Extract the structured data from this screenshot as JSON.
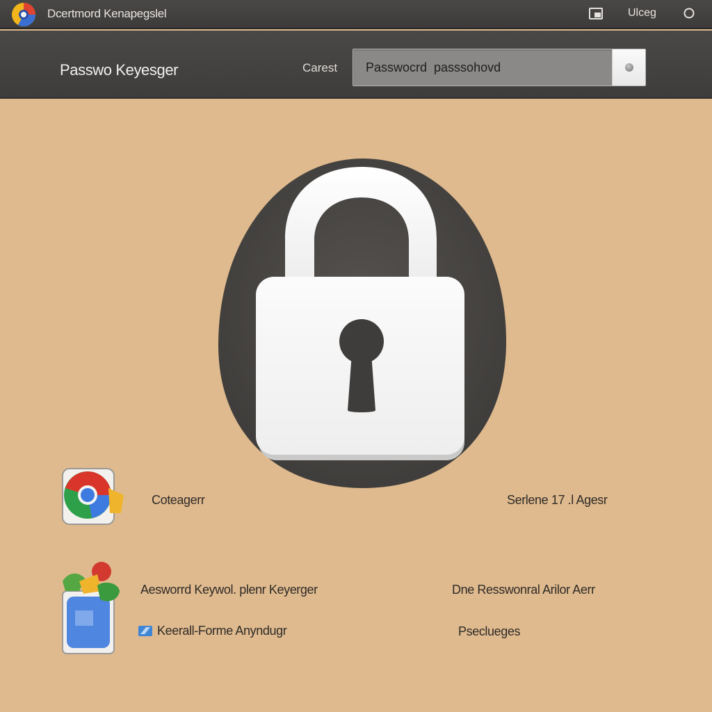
{
  "window": {
    "title": "Dcertmord Kenapegslel",
    "user_label": "Ulceg"
  },
  "header": {
    "title": "Passwo Keyesger",
    "search_label": "Carest",
    "search_value": "Passwocrd  passsohovd"
  },
  "content": {
    "row1": {
      "label": "Coteagerr",
      "right_label": "Serlene 17 .l Agesr"
    },
    "row2": {
      "label": "Aesworrd Keywol. plenr Keyerger",
      "right_label": "Dne Resswonral Arilor Aerr",
      "link_label": "Keerall-Forme Anyndugr",
      "right_sub_label": "Pseclueges"
    }
  },
  "icons": {
    "app_logo": "app-logo",
    "window_control": "window-icon",
    "help": "help-icon",
    "lock": "padlock-icon",
    "row1": "chrome-browser-icon",
    "row2": "folder-apps-icon"
  },
  "colors": {
    "background": "#dfba8e",
    "header": "#434241",
    "lock_body": "#f6f6f6",
    "lock_backdrop": "#4a4847",
    "text_dark": "#2f2b28"
  }
}
